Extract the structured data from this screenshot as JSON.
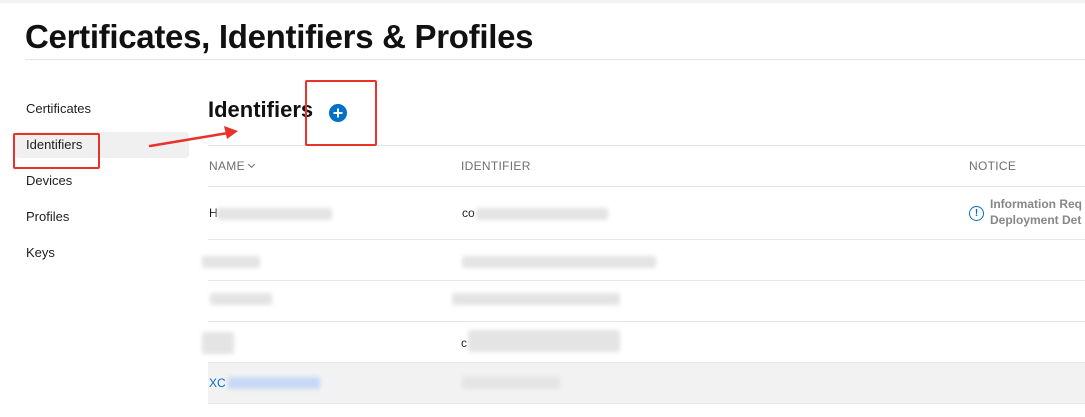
{
  "page_title": "Certificates, Identifiers & Profiles",
  "sidebar": {
    "items": [
      {
        "label": "Certificates",
        "active": false
      },
      {
        "label": "Identifiers",
        "active": true
      },
      {
        "label": "Devices",
        "active": false
      },
      {
        "label": "Profiles",
        "active": false
      },
      {
        "label": "Keys",
        "active": false
      }
    ]
  },
  "section": {
    "title": "Identifiers",
    "add_icon": "plus-circle-icon"
  },
  "table": {
    "columns": {
      "name": "NAME",
      "identifier": "IDENTIFIER",
      "notice": "NOTICE"
    },
    "rows": [
      {
        "name": "H",
        "identifier": "co",
        "notice_line1": "Information Req",
        "notice_line2": "Deployment Det"
      },
      {
        "name": "",
        "identifier": "",
        "notice_line1": "",
        "notice_line2": ""
      },
      {
        "name": "",
        "identifier": "",
        "notice_line1": "",
        "notice_line2": ""
      },
      {
        "name": "",
        "identifier": "c",
        "notice_line1": "",
        "notice_line2": ""
      },
      {
        "name": "XC",
        "identifier": "",
        "notice_line1": "",
        "notice_line2": ""
      }
    ]
  },
  "colors": {
    "accent": "#0070c9",
    "annotation": "#e8322b"
  }
}
